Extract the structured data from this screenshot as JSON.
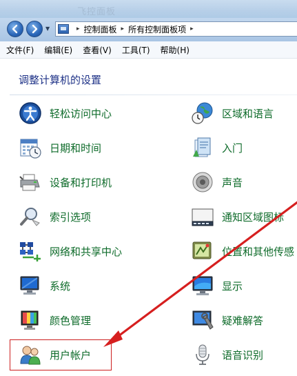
{
  "window": {
    "title_ghost": "飞控面板"
  },
  "address_bar": {
    "crumbs": [
      "控制面板",
      "所有控制面板项"
    ],
    "separator": "▸"
  },
  "menu": [
    "文件(F)",
    "编辑(E)",
    "查看(V)",
    "工具(T)",
    "帮助(H)"
  ],
  "page_title": "调整计算机的设置",
  "items_left": [
    {
      "label": "轻松访问中心",
      "icon": "ease-of-access-icon"
    },
    {
      "label": "日期和时间",
      "icon": "calendar-clock-icon"
    },
    {
      "label": "设备和打印机",
      "icon": "printer-icon"
    },
    {
      "label": "索引选项",
      "icon": "magnifier-icon"
    },
    {
      "label": "网络和共享中心",
      "icon": "network-icon"
    },
    {
      "label": "系统",
      "icon": "computer-icon"
    },
    {
      "label": "颜色管理",
      "icon": "color-monitor-icon"
    },
    {
      "label": "用户帐户",
      "icon": "users-icon"
    }
  ],
  "items_right": [
    {
      "label": "区域和语言",
      "icon": "globe-clock-icon"
    },
    {
      "label": "入门",
      "icon": "getting-started-icon"
    },
    {
      "label": "声音",
      "icon": "speaker-icon"
    },
    {
      "label": "通知区域图标",
      "icon": "taskbar-icon"
    },
    {
      "label": "位置和其他传感",
      "icon": "location-sensor-icon"
    },
    {
      "label": "显示",
      "icon": "display-icon"
    },
    {
      "label": "疑难解答",
      "icon": "troubleshoot-icon"
    },
    {
      "label": "语音识别",
      "icon": "microphone-icon"
    }
  ],
  "colors": {
    "link_green": "#0e6b2a",
    "title_blue": "#1e3287",
    "annotation_red": "#cc1d1d"
  }
}
